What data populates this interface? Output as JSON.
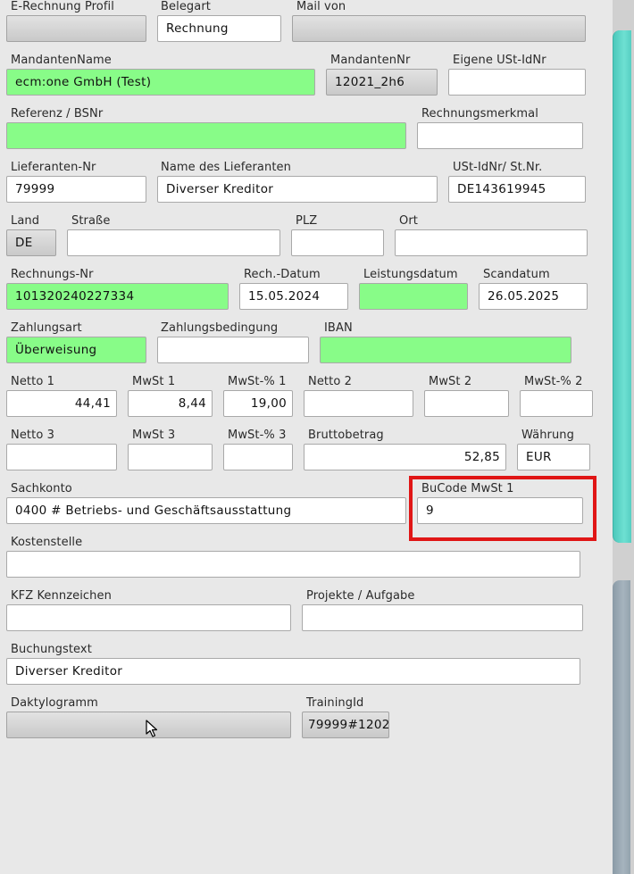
{
  "labels": {
    "erechnung_profil": "E-Rechnung Profil",
    "belegart": "Belegart",
    "mail_von": "Mail von",
    "mandanten_name": "MandantenName",
    "mandanten_nr": "MandantenNr",
    "eigene_ust": "Eigene USt-IdNr",
    "referenz": "Referenz / BSNr",
    "rechnungsmerkmal": "Rechnungsmerkmal",
    "lieferanten_nr": "Lieferanten-Nr",
    "lieferant_name": "Name des Lieferanten",
    "ust_stnr": "USt-IdNr/ St.Nr.",
    "land": "Land",
    "strasse": "Straße",
    "plz": "PLZ",
    "ort": "Ort",
    "rechnungs_nr": "Rechnungs-Nr",
    "rech_datum": "Rech.-Datum",
    "leistungsdatum": "Leistungsdatum",
    "scandatum": "Scandatum",
    "zahlungsart": "Zahlungsart",
    "zahlungsbedingung": "Zahlungsbedingung",
    "iban": "IBAN",
    "netto1": "Netto 1",
    "mwst1": "MwSt 1",
    "mwst_pct1": "MwSt-% 1",
    "netto2": "Netto 2",
    "mwst2": "MwSt 2",
    "mwst_pct2": "MwSt-% 2",
    "netto3": "Netto 3",
    "mwst3": "MwSt 3",
    "mwst_pct3": "MwSt-% 3",
    "bruttobetrag": "Bruttobetrag",
    "waehrung": "Währung",
    "sachkonto": "Sachkonto",
    "bucode": "BuCode MwSt 1",
    "kostenstelle": "Kostenstelle",
    "kfz": "KFZ Kennzeichen",
    "projekte": "Projekte / Aufgabe",
    "buchungstext": "Buchungstext",
    "daktylogramm": "Daktylogramm",
    "training_id": "TrainingId"
  },
  "values": {
    "erechnung_profil": "",
    "belegart": "Rechnung",
    "mail_von": "",
    "mandanten_name": "ecm:one GmbH (Test)",
    "mandanten_nr": "12021_2h6",
    "eigene_ust": "",
    "referenz": "",
    "rechnungsmerkmal": "",
    "lieferanten_nr": "79999",
    "lieferant_name": "Diverser Kreditor",
    "ust_stnr": "DE143619945",
    "land": "DE",
    "strasse": "",
    "plz": "",
    "ort": "",
    "rechnungs_nr": "101320240227334",
    "rech_datum": "15.05.2024",
    "leistungsdatum": "",
    "scandatum": "26.05.2025",
    "zahlungsart": "Überweisung",
    "zahlungsbedingung": "",
    "iban": "",
    "netto1": "44,41",
    "mwst1": "8,44",
    "mwst_pct1": "19,00",
    "netto2": "",
    "mwst2": "",
    "mwst_pct2": "",
    "netto3": "",
    "mwst3": "",
    "mwst_pct3": "",
    "bruttobetrag": "52,85",
    "waehrung": "EUR",
    "sachkonto": "0400 # Betriebs- und Geschäftsausstattung",
    "bucode": "9",
    "kostenstelle": "",
    "kfz": "",
    "projekte": "",
    "buchungstext": "Diverser Kreditor",
    "daktylogramm": "",
    "training_id": "79999#1202"
  },
  "colors": {
    "required_green": "#88fc88",
    "highlight_red": "#e01616",
    "scroll_teal": "#5fd6c9"
  }
}
